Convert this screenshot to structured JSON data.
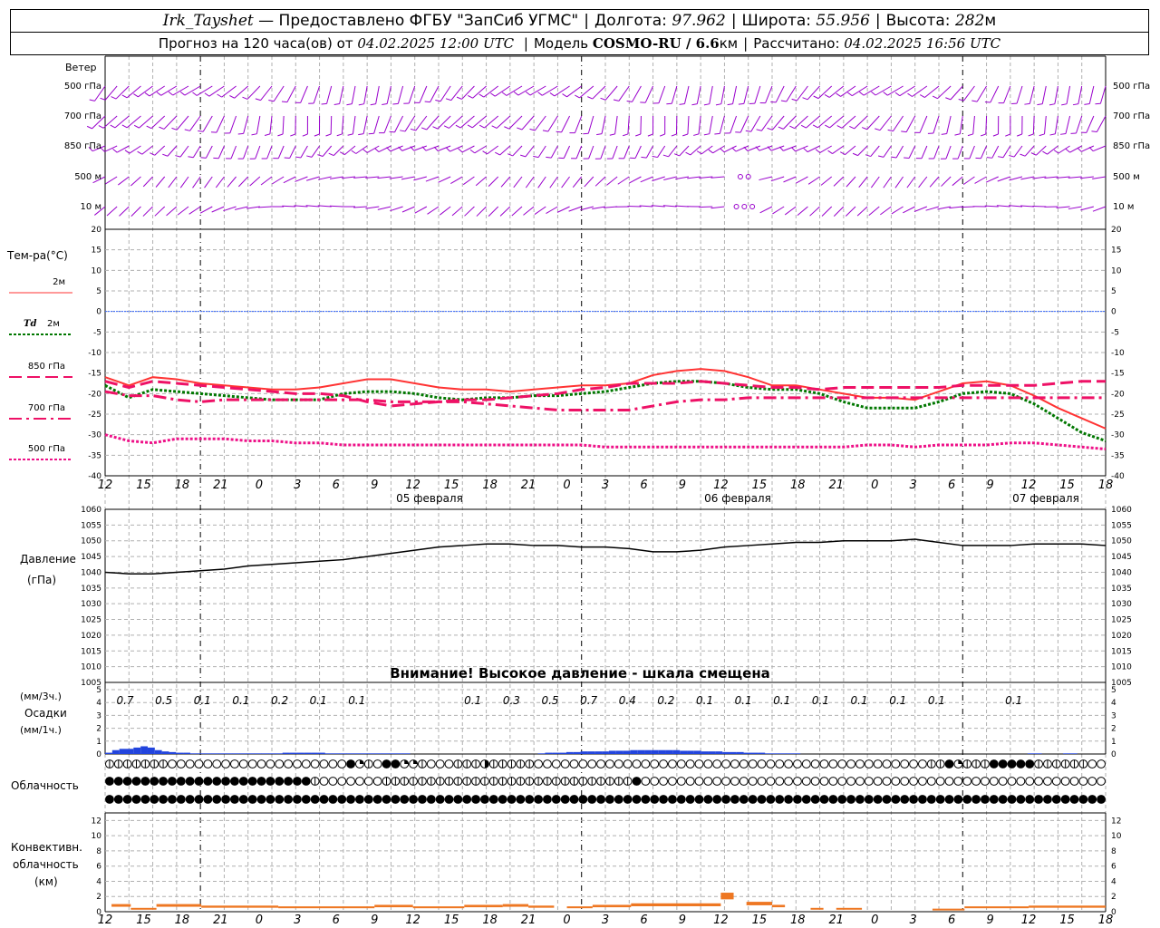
{
  "header": {
    "station": "Irk_Tayshet",
    "provider": "— Предоставлено ФГБУ \"ЗапСиб УГМС\"",
    "lon_label": "Долгота:",
    "lon_value": "97.962",
    "lat_label": "Широта:",
    "lat_value": "55.956",
    "alt_label": "Высота:",
    "alt_value": "282",
    "alt_unit": "м",
    "forecast_label": "Прогноз на 120 часа(ов) от",
    "forecast_date": "04.02.2025 12:00 UTC",
    "model_label": "Модель",
    "model_name": "COSMO-RU / 6.6",
    "model_unit": "км",
    "calc_label": "Рассчитано:",
    "calc_date": "04.02.2025 16:56 UTC"
  },
  "wind_panel": {
    "title": "Ветер",
    "levels": [
      "500 гПа",
      "700 гПа",
      "850 гПа",
      "500 м",
      "10 м"
    ],
    "color": "#9900cc"
  },
  "temp_panel": {
    "title": "Тем-ра(°C)",
    "legend": [
      {
        "label": "2м",
        "color": "#ff3333",
        "style": "solid"
      },
      {
        "label": "Td 2м",
        "color": "#007700",
        "style": "dotted"
      },
      {
        "label": "850 гПа",
        "color": "#ee1166",
        "style": "dashed"
      },
      {
        "label": "700 гПа",
        "color": "#ee1166",
        "style": "dashdot"
      },
      {
        "label": "500 гПа",
        "color": "#ee1188",
        "style": "dotted"
      }
    ]
  },
  "pressure_panel": {
    "title": "Давление",
    "unit": "(гПа)",
    "warning": "Внимание! Высокое давление - шкала смещена"
  },
  "precip_panel": {
    "unit3": "(мм/3ч.)",
    "title": "Осадки",
    "unit1": "(мм/1ч.)"
  },
  "cloud_panel": {
    "title": "Облачность"
  },
  "conv_panel": {
    "title_1": "Конвективн.",
    "title_2": "облачность",
    "title_3": "(км)"
  },
  "time_axis": {
    "hour_labels": [
      "12",
      "15",
      "18",
      "21",
      "0",
      "3",
      "6",
      "9",
      "12",
      "15",
      "18",
      "21",
      "0",
      "3",
      "6",
      "9",
      "12",
      "15",
      "18",
      "21",
      "0",
      "3",
      "6",
      "9",
      "12",
      "15",
      "18"
    ],
    "date_labels": [
      "05 февраля",
      "06 февраля",
      "07 февраля"
    ]
  },
  "chart_data": [
    {
      "type": "line",
      "title": "Тем-ра(°C)",
      "x_hours": [
        0,
        3,
        6,
        9,
        12,
        15,
        18,
        21,
        24,
        27,
        30,
        33,
        36,
        39,
        42,
        45,
        48,
        51,
        54,
        57,
        60,
        63,
        66,
        69,
        72,
        75,
        78,
        81,
        84,
        87,
        90,
        93,
        96,
        99,
        102,
        105,
        108,
        111,
        114,
        117,
        120,
        123,
        126
      ],
      "ylim": [
        -40,
        20
      ],
      "yticks": [
        20,
        15,
        10,
        5,
        0,
        -5,
        -10,
        -15,
        -20,
        -25,
        -30,
        -35,
        -40
      ],
      "zero_line": 0,
      "series": [
        {
          "name": "2м",
          "values": [
            -16,
            -18,
            -16,
            -16.5,
            -17.5,
            -18,
            -18.5,
            -19,
            -19,
            -18.5,
            -17.5,
            -16.5,
            -16.5,
            -17.5,
            -18.5,
            -19,
            -19,
            -19.5,
            -19,
            -18.5,
            -18,
            -18,
            -17.5,
            -15.5,
            -14.5,
            -14,
            -14.5,
            -16,
            -18,
            -18,
            -19,
            -20,
            -21,
            -21,
            -21.5,
            -19.5,
            -17.5,
            -17,
            -18,
            -20.5,
            -23.5,
            -26,
            -28.5
          ]
        },
        {
          "name": "Td 2м",
          "values": [
            -18,
            -21,
            -19,
            -19.5,
            -20,
            -20.5,
            -21,
            -21.5,
            -21.5,
            -21.5,
            -20,
            -19.5,
            -19.5,
            -20,
            -21,
            -21.5,
            -21,
            -21,
            -20.5,
            -20.5,
            -20,
            -19.5,
            -18.5,
            -17.5,
            -17,
            -17,
            -17.5,
            -18.5,
            -19,
            -19,
            -20,
            -22,
            -23.5,
            -23.5,
            -23.5,
            -22,
            -20,
            -19.5,
            -20,
            -22.5,
            -26,
            -29.5,
            -31.5
          ]
        },
        {
          "name": "850 гПа",
          "values": [
            -17,
            -18.5,
            -17,
            -17.5,
            -18,
            -18.5,
            -19,
            -19.5,
            -20,
            -20,
            -20.5,
            -22,
            -23,
            -22.5,
            -22,
            -21.5,
            -21.5,
            -21,
            -20.5,
            -20,
            -19,
            -18.5,
            -17.5,
            -17.5,
            -17.5,
            -17,
            -17.5,
            -18,
            -18.5,
            -18.5,
            -19,
            -18.5,
            -18.5,
            -18.5,
            -18.5,
            -18.5,
            -18,
            -18,
            -18,
            -18,
            -17.5,
            -17,
            -17
          ]
        },
        {
          "name": "700 гПа",
          "values": [
            -19.5,
            -20.5,
            -20.5,
            -21.5,
            -22,
            -21.5,
            -21.5,
            -21.5,
            -21.5,
            -21.5,
            -21.5,
            -21.5,
            -22,
            -22,
            -22,
            -22,
            -22.5,
            -23,
            -23.5,
            -24,
            -24,
            -24,
            -24,
            -23,
            -22,
            -21.5,
            -21.5,
            -21,
            -21,
            -21,
            -21,
            -21,
            -21,
            -21,
            -21,
            -21,
            -21,
            -21,
            -21,
            -21,
            -21,
            -21,
            -21
          ]
        },
        {
          "name": "500 гПа",
          "values": [
            -30,
            -31.5,
            -32,
            -31,
            -31,
            -31,
            -31.5,
            -31.5,
            -32,
            -32,
            -32.5,
            -32.5,
            -32.5,
            -32.5,
            -32.5,
            -32.5,
            -32.5,
            -32.5,
            -32.5,
            -32.5,
            -32.5,
            -33,
            -33,
            -33,
            -33,
            -33,
            -33,
            -33,
            -33,
            -33,
            -33,
            -33,
            -32.5,
            -32.5,
            -33,
            -32.5,
            -32.5,
            -32.5,
            -32,
            -32,
            -32.5,
            -33,
            -33.5
          ]
        }
      ]
    },
    {
      "type": "line",
      "title": "Давление (гПа)",
      "x_hours": [
        0,
        3,
        6,
        9,
        12,
        15,
        18,
        21,
        24,
        27,
        30,
        33,
        36,
        39,
        42,
        45,
        48,
        51,
        54,
        57,
        60,
        63,
        66,
        69,
        72,
        75,
        78,
        81,
        84,
        87,
        90,
        93,
        96,
        99,
        102,
        105,
        108,
        111,
        114,
        117,
        120,
        123,
        126
      ],
      "ylim": [
        1005,
        1060
      ],
      "yticks": [
        1060,
        1055,
        1050,
        1045,
        1040,
        1035,
        1030,
        1025,
        1020,
        1015,
        1010,
        1005
      ],
      "series": [
        {
          "name": "Давление",
          "values": [
            1040,
            1039.5,
            1039.5,
            1040,
            1040.5,
            1041,
            1042,
            1042.5,
            1043,
            1043.5,
            1044,
            1045,
            1046,
            1047,
            1048,
            1048.5,
            1049,
            1049,
            1048.5,
            1048.5,
            1048,
            1048,
            1047.5,
            1046.5,
            1046.5,
            1047,
            1048,
            1048.5,
            1049,
            1049.5,
            1049.5,
            1050,
            1050,
            1050,
            1050.5,
            1049.5,
            1048.5,
            1048.5,
            1048.5,
            1049,
            1049,
            1049,
            1048.5
          ]
        }
      ]
    },
    {
      "type": "bar",
      "title": "Осадки",
      "ylim": [
        0,
        5
      ],
      "yticks": [
        5,
        4,
        3,
        2,
        1,
        0
      ],
      "totals_3h": [
        "0.7",
        "0.5",
        "0.1",
        "0.1",
        "0.2",
        "0.1",
        "0.1",
        "",
        "",
        "0.1",
        "0.3",
        "0.5",
        "0.7",
        "0.4",
        "0.2",
        "0.1",
        "0.1",
        "0.1",
        "0.1",
        "0.1",
        "0.1",
        "0.1",
        "",
        "0.1",
        "",
        ""
      ],
      "hourly_mm": [
        0.1,
        0.3,
        0.4,
        0.4,
        0.5,
        0.6,
        0.5,
        0.3,
        0.2,
        0.15,
        0.1,
        0.1,
        0.05,
        0.05,
        0.05,
        0.05,
        0.05,
        0.05,
        0.05,
        0.05,
        0.05,
        0.05,
        0.05,
        0.05,
        0.05,
        0.1,
        0.1,
        0.1,
        0.1,
        0.1,
        0.1,
        0.05,
        0.05,
        0.05,
        0.05,
        0.05,
        0.05,
        0.05,
        0.05,
        0.05,
        0.05,
        0.05,
        0.05,
        0,
        0,
        0,
        0,
        0,
        0,
        0,
        0,
        0,
        0,
        0,
        0,
        0,
        0,
        0,
        0,
        0,
        0,
        0.05,
        0.1,
        0.1,
        0.1,
        0.15,
        0.15,
        0.2,
        0.2,
        0.2,
        0.2,
        0.25,
        0.25,
        0.25,
        0.3,
        0.3,
        0.3,
        0.3,
        0.3,
        0.3,
        0.3,
        0.25,
        0.25,
        0.25,
        0.2,
        0.2,
        0.2,
        0.15,
        0.15,
        0.15,
        0.1,
        0.1,
        0.1,
        0.05,
        0.05,
        0.05,
        0.05,
        0.05,
        0,
        0,
        0,
        0,
        0,
        0,
        0,
        0,
        0,
        0,
        0,
        0,
        0,
        0,
        0,
        0,
        0,
        0,
        0,
        0,
        0,
        0,
        0,
        0,
        0,
        0,
        0,
        0,
        0,
        0,
        0,
        0,
        0.05,
        0.05,
        0,
        0,
        0,
        0.05,
        0.05,
        0,
        0,
        0,
        0
      ]
    },
    {
      "type": "bar",
      "title": "Конвективн. облачность (км)",
      "ylim": [
        0,
        13
      ],
      "yticks": [
        12,
        10,
        8,
        6,
        4,
        2,
        0
      ],
      "segments_h": [
        {
          "from": 1,
          "to": 4,
          "value": 1
        },
        {
          "from": 4,
          "to": 8,
          "value": 0.5
        },
        {
          "from": 8,
          "to": 15,
          "value": 1
        },
        {
          "from": 15,
          "to": 27,
          "value": 0.8
        },
        {
          "from": 27,
          "to": 42,
          "value": 0.7
        },
        {
          "from": 42,
          "to": 48,
          "value": 0.9
        },
        {
          "from": 48,
          "to": 56,
          "value": 0.7
        },
        {
          "from": 56,
          "to": 62,
          "value": 0.9
        },
        {
          "from": 62,
          "to": 66,
          "value": 1
        },
        {
          "from": 66,
          "to": 70,
          "value": 0.8
        },
        {
          "from": 72,
          "to": 76,
          "value": 0.7
        },
        {
          "from": 76,
          "to": 82,
          "value": 0.9
        },
        {
          "from": 82,
          "to": 96,
          "value": 1.1
        },
        {
          "from": 96,
          "to": 98,
          "value": 2.5
        },
        {
          "from": 100,
          "to": 104,
          "value": 1.3
        },
        {
          "from": 104,
          "to": 106,
          "value": 0.9
        },
        {
          "from": 110,
          "to": 112,
          "value": 0.5
        },
        {
          "from": 114,
          "to": 118,
          "value": 0.5
        },
        {
          "from": 129,
          "to": 134,
          "value": 0.4
        },
        {
          "from": 134,
          "to": 144,
          "value": 0.7
        },
        {
          "from": 144,
          "to": 156,
          "value": 0.8
        }
      ]
    },
    {
      "type": "table",
      "title": "Облачность",
      "rows": [
        "1111111000000000000000000002310223310001114111110000000000000000000000000000000000000000000011231112222211111100",
        "2222222222222222222222210000000111111111111111111111111111120000000000000000000000000000000000000000000000000000",
        "2222222222222222222222222222222222222222222222222222222222222222222222222222222222222222222222222222222222222222"
      ]
    }
  ]
}
